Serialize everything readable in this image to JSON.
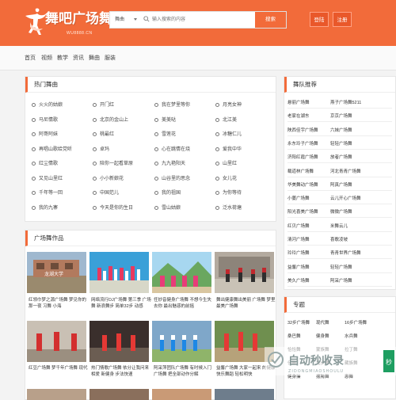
{
  "brand": {
    "name": "舞吧广场舞",
    "url": "WU8888.CN",
    "accent": "#f26b3a"
  },
  "search": {
    "category": "舞曲",
    "placeholder": "输入搜索的内容",
    "button": "搜索"
  },
  "header_buttons": {
    "login": "登陆",
    "register": "注册"
  },
  "nav": [
    "首页",
    "视频",
    "教学",
    "资讯",
    "舞曲",
    "服装"
  ],
  "hot_songs": {
    "title": "热门舞曲",
    "items": [
      "火火的姑娘",
      "开门红",
      "我在梦里等你",
      "月亮女神",
      "马尼情歌",
      "北京的金山上",
      "美美哒",
      "北江美",
      "阿哥阿妹",
      "桃最红",
      "雪莲花",
      "冰糖仁儿",
      "再唱山歌给党听",
      "卓玛",
      "心在跳情在烧",
      "爱我中华",
      "红尘情歌",
      "陪你一起看草原",
      "九九艳阳天",
      "山里红",
      "又见山里红",
      "小小新娘花",
      "山谷里的思念",
      "女儿花",
      "千年等一回",
      "中国范儿",
      "我的祖国",
      "为你等待",
      "我的九寨",
      "今天是你的生日",
      "雪山姑娘",
      "泛水荷塘"
    ]
  },
  "works": {
    "title": "广场舞作品",
    "videos": [
      {
        "caption": "红领巾梦之源广场舞 梦见你的那一夜 习舞 小海"
      },
      {
        "caption": "网络流行DJ广场舞 第三季 广场舞 新浪舞步 简单32步 动感"
      },
      {
        "caption": "任妙音健身广场舞 不想今生失去你 最出魅惑的前摇"
      },
      {
        "caption": "舞出健康舞出美丽 广场舞 梦里 最美广场舞"
      },
      {
        "caption": "红豆广场舞 梦千年广场舞 现代"
      },
      {
        "caption": "热门情歌广场舞 依分让我问来相爱 新健身 步法快速"
      },
      {
        "caption": "阿采萍团队广场舞 有时候入门广场舞 把全部动作分解"
      },
      {
        "caption": "益馨广场舞 大家一起来 的健康快乐舞蹈 轻松明快"
      }
    ]
  },
  "teams": {
    "title": "舞队推荐",
    "left": [
      "悬丽广场舞",
      "老家在湖东",
      "陕西佳宇广场舞",
      "永东玲子广场舞",
      "济阳红霞广场舞",
      "载道林广场舞",
      "华美舞动广场舞",
      "小蔓广场舞",
      "阳光喜美广场舞",
      "红贝广场舞",
      "清河广场舞",
      "玲玲广场舞",
      "益馨广场舞",
      "美久广场舞"
    ],
    "right": [
      "燕子广场舞5211",
      "京京广场舞",
      "六妹广场舞",
      "轻轻广场舞",
      "放者广场舞",
      "河北青青广场舞",
      "阿真广场舞",
      "云儿开心广场舞",
      "微微广场舞",
      "米舞云儿",
      "喜歌凌坡",
      "青青世界广场舞",
      "轻轻广场舞",
      "阿采广场舞"
    ]
  },
  "topics": {
    "title": "专题",
    "items": [
      "32步广场舞",
      "现代舞",
      "16步广场舞",
      "桑巴舞",
      "健身舞",
      "水兵舞",
      "恰恰舞",
      "蒙族舞",
      "拉丁舞",
      "佳舞",
      "鬼步舞",
      "藏族舞",
      "健身操",
      "摆胯舞",
      "惠舞"
    ]
  },
  "watermark": {
    "text": "自动秒收录",
    "sub": "ZIDONGMIAOSHOULU"
  }
}
